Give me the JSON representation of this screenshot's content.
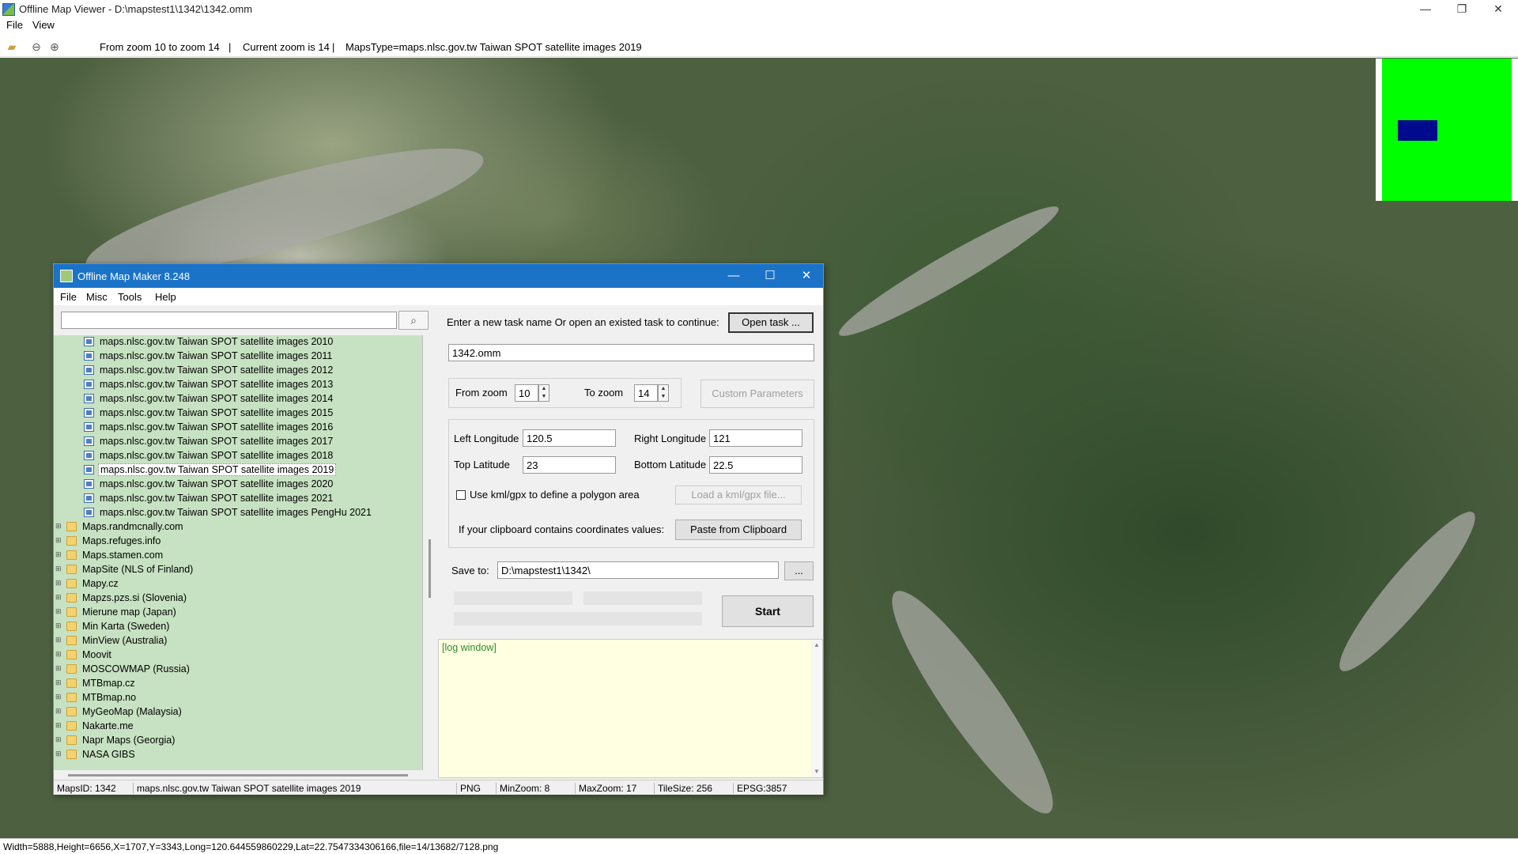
{
  "viewer": {
    "title": "Offline Map Viewer - D:\\mapstest1\\1342\\1342.omm",
    "menu": [
      "File",
      "View"
    ],
    "toolbar": {
      "zoom_range": "From zoom 10 to zoom 14",
      "sep1": "|",
      "current_zoom": "Current zoom is 14",
      "sep2": "|",
      "maps_type": "MapsType=maps.nlsc.gov.tw Taiwan SPOT satellite images 2019"
    },
    "window_buttons": {
      "minimize": "—",
      "maximize": "❐",
      "close": "✕"
    },
    "status": "Width=5888,Height=6656,X=1707,Y=3343,Long=120.644559860229,Lat=22.7547334306166,file=14/13682/7128.png",
    "overview_colors": {
      "background": "#00ff00",
      "viewport": "#000a8c"
    }
  },
  "dialog": {
    "title": "Offline Map Maker 8.248",
    "window_buttons": {
      "minimize": "—",
      "maximize": "☐",
      "close": "✕"
    },
    "menu": [
      "File",
      "Misc",
      "Tools",
      "Help"
    ],
    "search": {
      "value": "",
      "icon": "search-icon"
    },
    "tree": [
      {
        "label": "maps.nlsc.gov.tw Taiwan SPOT satellite images 2010",
        "type": "map"
      },
      {
        "label": "maps.nlsc.gov.tw Taiwan SPOT satellite images 2011",
        "type": "map"
      },
      {
        "label": "maps.nlsc.gov.tw Taiwan SPOT satellite images 2012",
        "type": "map"
      },
      {
        "label": "maps.nlsc.gov.tw Taiwan SPOT satellite images 2013",
        "type": "map"
      },
      {
        "label": "maps.nlsc.gov.tw Taiwan SPOT satellite images 2014",
        "type": "map"
      },
      {
        "label": "maps.nlsc.gov.tw Taiwan SPOT satellite images 2015",
        "type": "map"
      },
      {
        "label": "maps.nlsc.gov.tw Taiwan SPOT satellite images 2016",
        "type": "map"
      },
      {
        "label": "maps.nlsc.gov.tw Taiwan SPOT satellite images 2017",
        "type": "map"
      },
      {
        "label": "maps.nlsc.gov.tw Taiwan SPOT satellite images 2018",
        "type": "map"
      },
      {
        "label": "maps.nlsc.gov.tw Taiwan SPOT satellite images 2019",
        "type": "map",
        "selected": true
      },
      {
        "label": "maps.nlsc.gov.tw Taiwan SPOT satellite images 2020",
        "type": "map"
      },
      {
        "label": "maps.nlsc.gov.tw Taiwan SPOT satellite images 2021",
        "type": "map"
      },
      {
        "label": "maps.nlsc.gov.tw Taiwan SPOT satellite images PengHu 2021",
        "type": "map"
      },
      {
        "label": "Maps.randmcnally.com",
        "type": "folder"
      },
      {
        "label": "Maps.refuges.info",
        "type": "folder"
      },
      {
        "label": "Maps.stamen.com",
        "type": "folder"
      },
      {
        "label": "MapSite (NLS of Finland)",
        "type": "folder"
      },
      {
        "label": "Mapy.cz",
        "type": "folder"
      },
      {
        "label": "Mapzs.pzs.si (Slovenia)",
        "type": "folder"
      },
      {
        "label": "Mierune map (Japan)",
        "type": "folder"
      },
      {
        "label": "Min Karta (Sweden)",
        "type": "folder"
      },
      {
        "label": "MinView (Australia)",
        "type": "folder"
      },
      {
        "label": "Moovit",
        "type": "folder"
      },
      {
        "label": "MOSCOWMAP (Russia)",
        "type": "folder"
      },
      {
        "label": "MTBmap.cz",
        "type": "folder"
      },
      {
        "label": "MTBmap.no",
        "type": "folder"
      },
      {
        "label": "MyGeoMap (Malaysia)",
        "type": "folder"
      },
      {
        "label": "Nakarte.me",
        "type": "folder"
      },
      {
        "label": "Napr Maps (Georgia)",
        "type": "folder"
      },
      {
        "label": "NASA GIBS",
        "type": "folder"
      }
    ],
    "form": {
      "task_prompt": "Enter a new task name Or open an existed task to continue:",
      "open_task_button": "Open task ...",
      "task_name": "1342.omm",
      "from_zoom_label": "From zoom",
      "from_zoom": "10",
      "to_zoom_label": "To zoom",
      "to_zoom": "14",
      "custom_params_button": "Custom Parameters",
      "left_lon_label": "Left Longitude",
      "left_lon": "120.5",
      "right_lon_label": "Right Longitude",
      "right_lon": "121",
      "top_lat_label": "Top Latitude",
      "top_lat": "23",
      "bottom_lat_label": "Bottom Latitude",
      "bottom_lat": "22.5",
      "kml_checkbox_label": "Use kml/gpx to define a polygon area",
      "kml_checked": false,
      "load_kml_button": "Load a kml/gpx file...",
      "clipboard_label": "If your clipboard contains coordinates values:",
      "paste_button": "Paste from Clipboard",
      "save_to_label": "Save to:",
      "save_to": "D:\\mapstest1\\1342\\",
      "browse_button": "...",
      "start_button": "Start"
    },
    "log": "[log window]",
    "status": {
      "maps_id": "MapsID: 1342",
      "maps_name": "maps.nlsc.gov.tw Taiwan SPOT satellite images 2019",
      "format": "PNG",
      "min_zoom": "MinZoom: 8",
      "max_zoom": "MaxZoom: 17",
      "tile_size": "TileSize: 256",
      "epsg": "EPSG:3857"
    }
  }
}
